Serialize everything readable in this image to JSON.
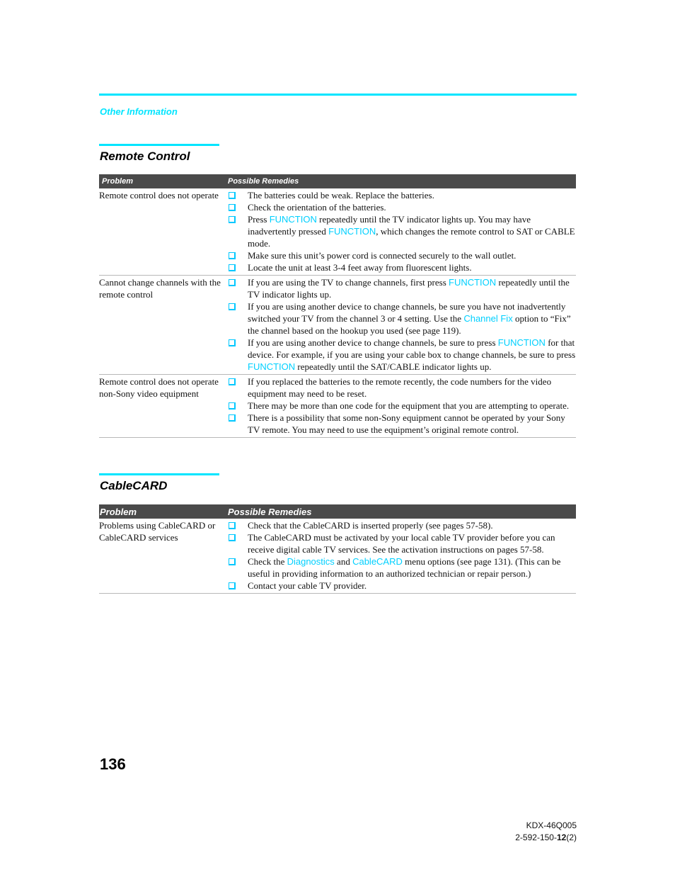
{
  "header": {
    "section_label": "Other Information"
  },
  "sections": [
    {
      "title": "Remote Control",
      "col_problem": "Problem",
      "col_remedies": "Possible Remedies",
      "rows": [
        {
          "problem": "Remote control does not operate",
          "remedies": [
            [
              {
                "t": "The batteries could be weak. Replace the batteries."
              }
            ],
            [
              {
                "t": "Check the orientation of the batteries."
              }
            ],
            [
              {
                "t": "Press "
              },
              {
                "k": "FUNCTION"
              },
              {
                "t": " repeatedly until the TV indicator lights up. You may have inadvertently pressed "
              },
              {
                "k": "FUNCTION"
              },
              {
                "t": ", which changes the remote control to SAT or CABLE mode."
              }
            ],
            [
              {
                "t": "Make sure this unit’s power cord is connected securely to the wall outlet."
              }
            ],
            [
              {
                "t": "Locate the unit at least 3-4 feet away from fluorescent lights."
              }
            ]
          ]
        },
        {
          "problem": "Cannot change channels with the remote control",
          "remedies": [
            [
              {
                "t": "If you are using the TV to change channels, first press "
              },
              {
                "k": "FUNCTION"
              },
              {
                "t": " repeatedly until the TV indicator lights up."
              }
            ],
            [
              {
                "t": "If you are using another device to change channels, be sure you have not inadvertently switched your TV from the channel 3 or 4 setting. Use the "
              },
              {
                "k": "Channel Fix"
              },
              {
                "t": " option to “Fix” the channel based on the hookup you used (see page 119)."
              }
            ],
            [
              {
                "t": "If you are using another device to change channels, be sure to press "
              },
              {
                "k": "FUNCTION"
              },
              {
                "t": " for that device. For example, if you are using your cable box to change channels, be sure to press "
              },
              {
                "k": "FUNCTION"
              },
              {
                "t": " repeatedly until the SAT/CABLE indicator lights up."
              }
            ]
          ]
        },
        {
          "problem": "Remote control does not operate non-Sony video equipment",
          "remedies": [
            [
              {
                "t": "If you replaced the batteries to the remote recently, the code numbers for the video equipment may need to be reset."
              }
            ],
            [
              {
                "t": "There may be more than one code for the equipment that you are attempting to operate."
              }
            ],
            [
              {
                "t": "There is a possibility that some non-Sony equipment cannot be operated by your Sony TV remote. You may need to use the equipment’s original remote control."
              }
            ]
          ]
        }
      ]
    },
    {
      "title": "CableCARD",
      "col_problem": "Problem",
      "col_remedies": "Possible Remedies",
      "rows": [
        {
          "problem": "Problems using CableCARD or CableCARD services",
          "remedies": [
            [
              {
                "t": "Check that the CableCARD is inserted properly (see pages 57-58)."
              }
            ],
            [
              {
                "t": "The CableCARD must be activated by your local cable TV provider before you can receive digital cable TV services. See the activation instructions on pages 57-58."
              }
            ],
            [
              {
                "t": "Check the "
              },
              {
                "k": "Diagnostics"
              },
              {
                "t": " and "
              },
              {
                "k": "CableCARD"
              },
              {
                "t": " menu options (see page 131). (This can be useful in providing information to an authorized technician or repair person.)"
              }
            ],
            [
              {
                "t": "Contact your cable TV provider."
              }
            ]
          ]
        }
      ]
    }
  ],
  "footer": {
    "page_number": "136",
    "model": "KDX-46Q005",
    "code_prefix": "2-592-150-",
    "code_bold": "12",
    "code_suffix": "(2)"
  },
  "icons": {
    "bullet": "checkbox-bullet-icon"
  },
  "colors": {
    "accent": "#00e5ff",
    "header_bg": "#4a4a4a"
  }
}
